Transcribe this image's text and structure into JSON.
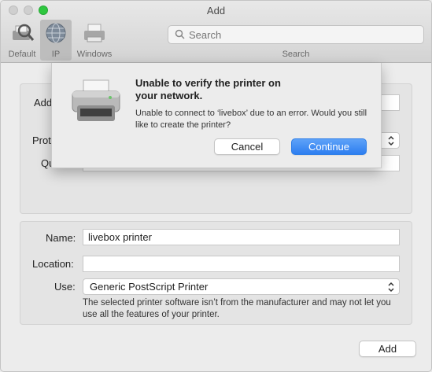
{
  "window": {
    "title": "Add"
  },
  "toolbar": {
    "items": [
      {
        "label": "Default",
        "icon": "default-printer-icon"
      },
      {
        "label": "IP",
        "icon": "globe-icon",
        "selected": true
      },
      {
        "label": "Windows",
        "icon": "windows-printer-icon"
      }
    ],
    "search_placeholder": "Search",
    "search_label": "Search"
  },
  "form": {
    "address_label": "Add",
    "protocol_label": "Prot",
    "queue_label": "Qu",
    "name_label": "Name:",
    "name_value": "livebox printer",
    "location_label": "Location:",
    "location_value": "",
    "use_label": "Use:",
    "use_value": "Generic PostScript Printer",
    "help_text": "The selected printer software isn’t from the manufacturer and may not let you use all the features of your printer.",
    "add_button": "Add"
  },
  "alert": {
    "icon": "printer-icon",
    "title": "Unable to verify the printer on your network.",
    "message": "Unable to connect to ‘livebox’ due to an error. Would you still like to create the printer?",
    "cancel_label": "Cancel",
    "continue_label": "Continue"
  },
  "colors": {
    "accent": "#2d7ef0",
    "zoom_button": "#2ec73f"
  }
}
